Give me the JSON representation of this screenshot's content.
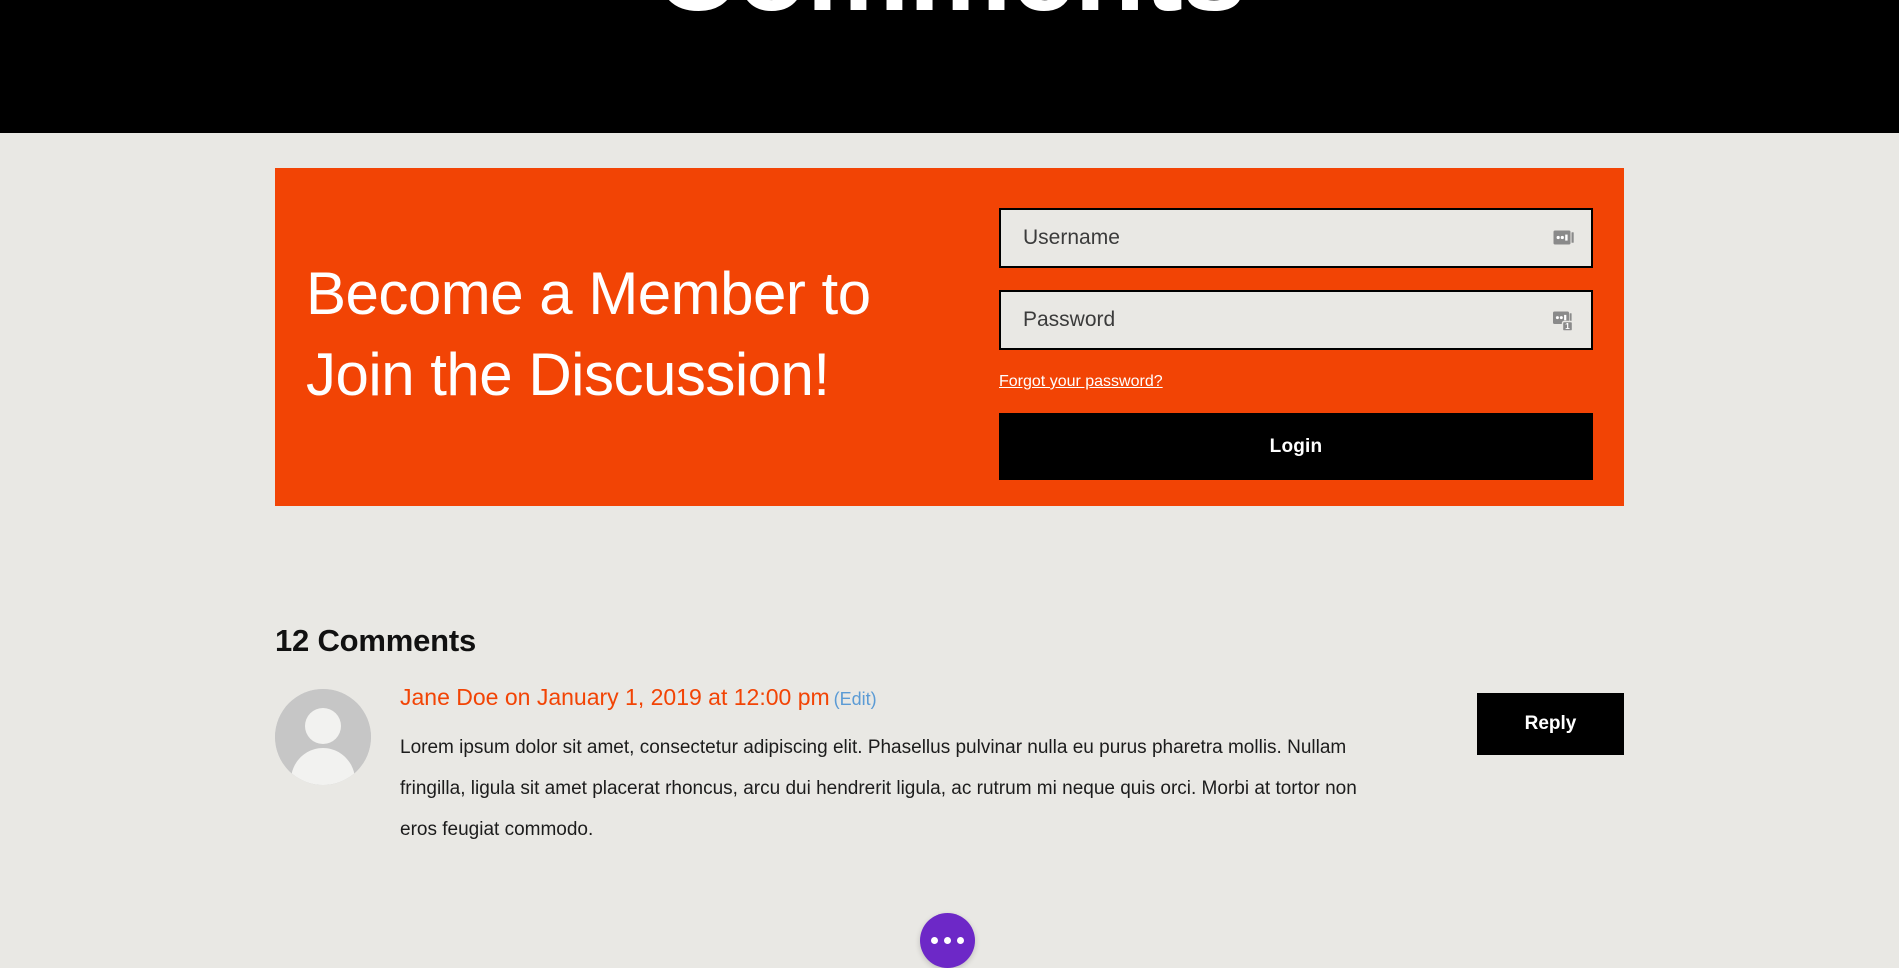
{
  "hero": {
    "title": "Comments"
  },
  "membership": {
    "heading": "Become a Member to Join the Discussion!",
    "username": {
      "placeholder": "Username",
      "value": "",
      "icon": "password-manager-icon"
    },
    "password": {
      "placeholder": "Password",
      "value": "",
      "icon": "password-manager-badge-icon",
      "badge_count": "1"
    },
    "forgot_password_label": "Forgot your password?",
    "login_label": "Login",
    "panel_color": "#f24405",
    "button_color": "#000000"
  },
  "comments": {
    "count_label": "12 Comments",
    "items": [
      {
        "author": "Jane Doe",
        "meta_connector": " on ",
        "date": "January 1, 2019 at 12:00 pm",
        "edit_label": "(Edit)",
        "avatar": "default-user-avatar",
        "text": "Lorem ipsum dolor sit amet, consectetur adipiscing elit. Phasellus pulvinar nulla eu purus pharetra mollis. Nullam fringilla, ligula sit amet placerat rhoncus, arcu dui hendrerit ligula, ac rutrum mi neque quis orci. Morbi at tortor non eros feugiat commodo.",
        "reply_label": "Reply"
      }
    ],
    "meta_color": "#f24405",
    "edit_link_color": "#5b9bd5"
  },
  "fab": {
    "icon": "ellipsis-icon",
    "color": "#6d28c7"
  },
  "theme": {
    "background": "#e9e8e4",
    "header_background": "#000000",
    "accent": "#f24405"
  }
}
